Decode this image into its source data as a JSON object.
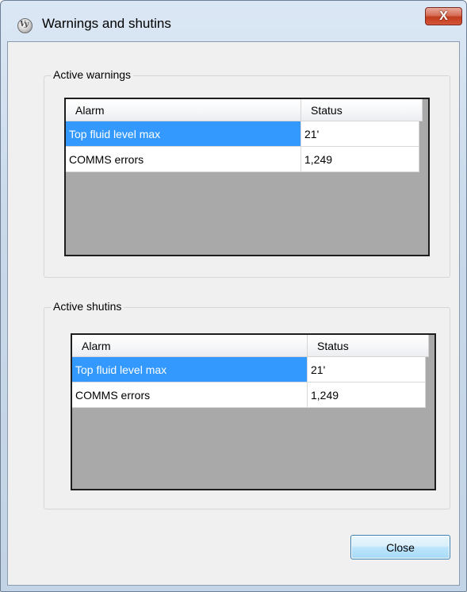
{
  "window": {
    "title": "Warnings and shutins",
    "close_glyph": "X",
    "icon": "app-logo-icon"
  },
  "warnings": {
    "group_title": "Active warnings",
    "columns": [
      "Alarm",
      "Status"
    ],
    "rows": [
      {
        "alarm": "Top fluid level max",
        "status": "21'",
        "selected": true
      },
      {
        "alarm": "COMMS errors",
        "status": "1,249",
        "selected": false
      }
    ]
  },
  "shutins": {
    "group_title": "Active shutins",
    "columns": [
      "Alarm",
      "Status"
    ],
    "rows": [
      {
        "alarm": "Top fluid level max",
        "status": "21'",
        "selected": true
      },
      {
        "alarm": "COMMS errors",
        "status": "1,249",
        "selected": false
      }
    ]
  },
  "footer": {
    "close_label": "Close"
  },
  "colors": {
    "selection": "#3399ff",
    "grid_background": "#a9a9a9"
  }
}
